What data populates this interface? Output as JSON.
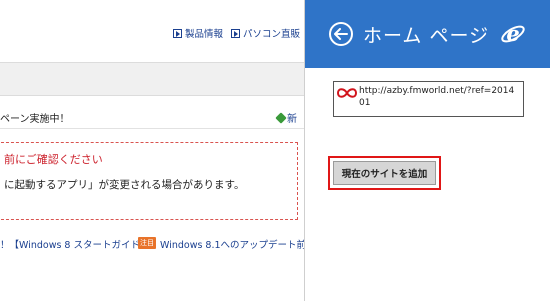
{
  "webpage": {
    "nav": {
      "product_info": "製品情報",
      "pc_direct": "パソコン直販"
    },
    "campaign_text": "ペーン実施中！",
    "campaign_right": "新",
    "notice_title": "前にご確認ください",
    "notice_body": "に起動するアプリ」が変更される場合があります。",
    "bottom_link_1": "！【Windows 8 スタートガイド】",
    "bottom_badge": "注目",
    "bottom_link_2": "Windows 8.1へのアップデート前に"
  },
  "charm": {
    "title": "ホーム ページ",
    "header_color": "#2f74c8",
    "back_icon": "back-arrow-circle-icon",
    "browser_icon": "ie-logo-icon",
    "url": "http://azby.fmworld.net/?ref=201401",
    "add_button_label": "現在のサイトを追加",
    "highlight_color": "#e01616"
  }
}
